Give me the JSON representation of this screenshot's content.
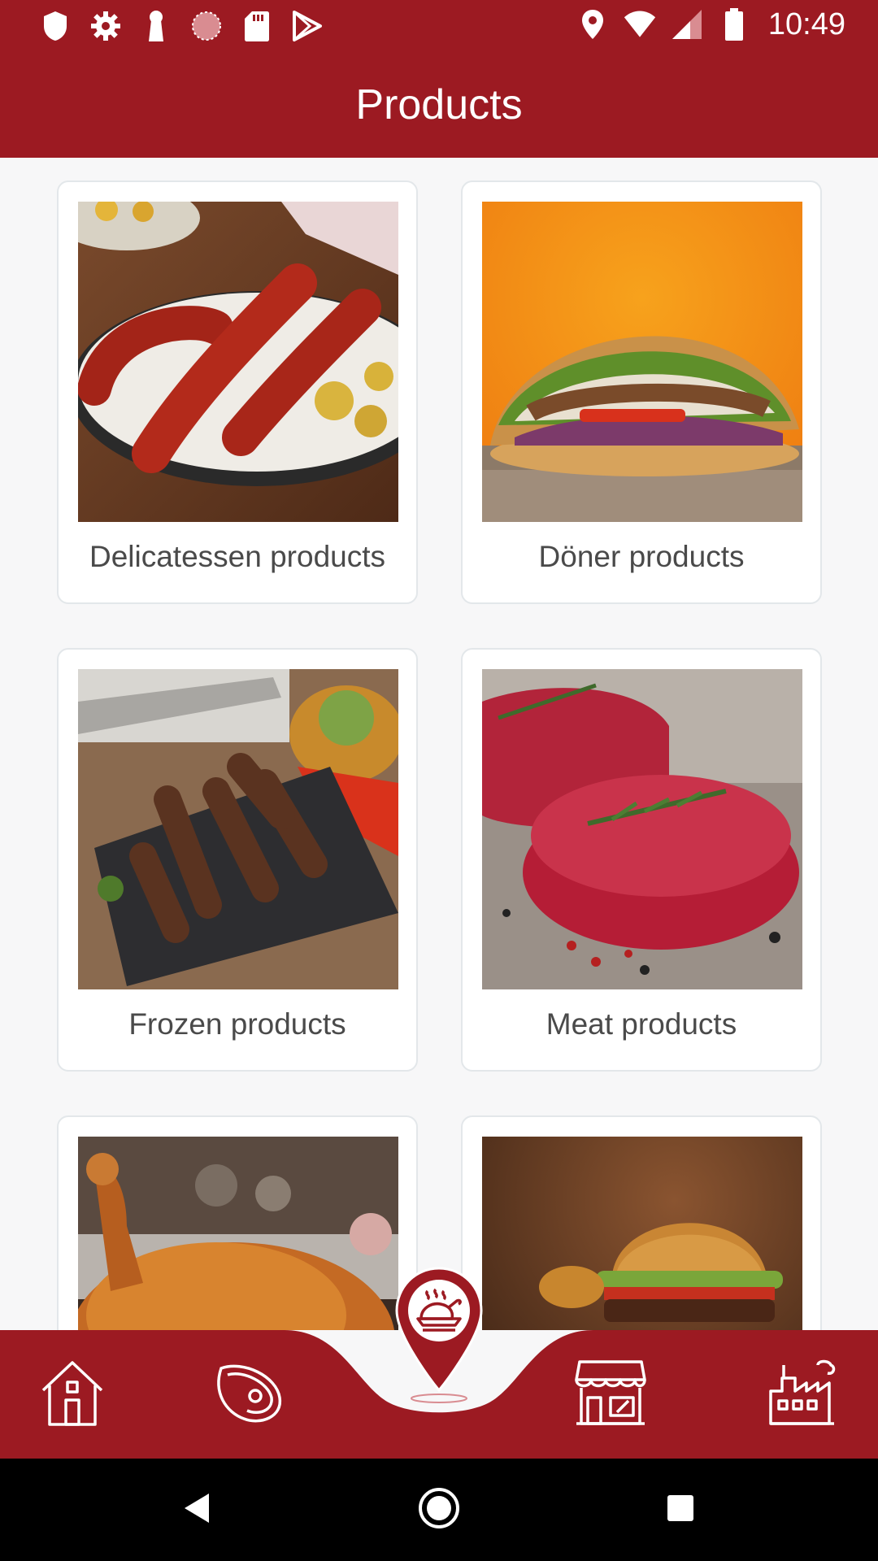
{
  "status_bar": {
    "time": "10:49",
    "left_icons": [
      "shield-icon",
      "gear-icon",
      "keyhole-icon",
      "sync-icon",
      "sd-card-icon",
      "play-store-icon"
    ],
    "right_icons": [
      "location-icon",
      "wifi-icon",
      "signal-icon",
      "battery-icon"
    ]
  },
  "app_bar": {
    "title": "Products"
  },
  "products": [
    {
      "label": "Delicatessen products",
      "image": "sausages-photo"
    },
    {
      "label": "Döner products",
      "image": "doner-photo"
    },
    {
      "label": "Frozen products",
      "image": "cevapi-photo"
    },
    {
      "label": "Meat products",
      "image": "steak-photo"
    },
    {
      "label": "",
      "image": "roast-chicken-photo"
    },
    {
      "label": "",
      "image": "burger-photo"
    }
  ],
  "bottom_nav": {
    "items": [
      "home-icon",
      "meat-icon",
      "roast-chicken-icon",
      "shop-icon",
      "factory-icon"
    ],
    "active": "roast-chicken-icon"
  },
  "colors": {
    "brand": "#9c1a22",
    "background": "#f7f7f8",
    "card_border": "#e3e7ea",
    "label": "#4a4a4a"
  }
}
